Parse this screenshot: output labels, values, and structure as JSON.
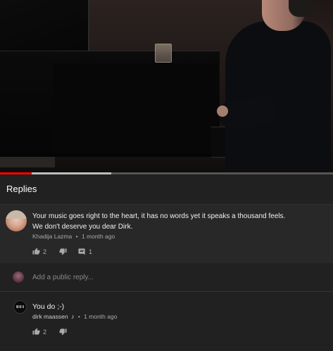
{
  "player": {
    "progress": 0.095,
    "buffered": 0.335,
    "colors": {
      "played": "#ff0000",
      "buffer": "#bdbdbd",
      "track": "#555555"
    }
  },
  "replies_panel": {
    "title": "Replies"
  },
  "parent_comment": {
    "avatar_icon": "user-avatar-photo",
    "text_line1": "Your music goes right to the heart, it has no words yet it speaks a thousand feels.",
    "text_line2": "We don't deserve you dear Dirk.",
    "author": "Khadija Lazma",
    "separator": "•",
    "time": "1 month ago",
    "likes": "2",
    "replies": "1",
    "icons": {
      "like": "thumb-up-icon",
      "dislike": "thumb-down-icon",
      "reply": "reply-icon"
    }
  },
  "add_reply": {
    "placeholder": "Add a public reply..."
  },
  "reply_comment": {
    "avatar_icon": "channel-logo-avatar",
    "text": "You do ;-)",
    "author": "dirk maassen",
    "badge": "♪",
    "separator": "•",
    "time": "1 month ago",
    "likes": "2",
    "icons": {
      "like": "thumb-up-icon",
      "dislike": "thumb-down-icon"
    }
  }
}
